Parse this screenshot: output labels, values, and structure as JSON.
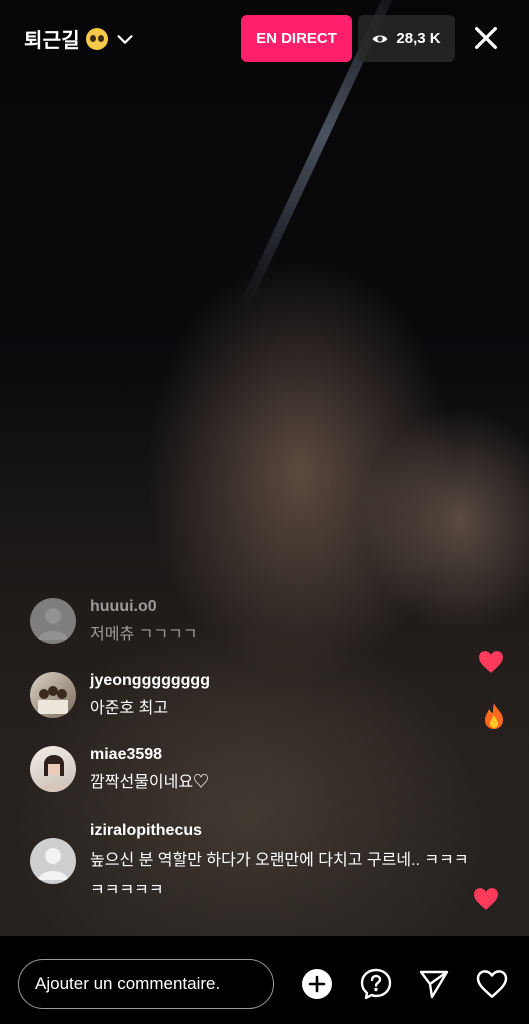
{
  "header": {
    "title": "퇴근길",
    "title_emoji": "pleading-face-emoji",
    "live_label": "EN DIRECT",
    "viewer_count": "28,3 K"
  },
  "comments": [
    {
      "username": "huuui.o0",
      "text": "저메츄 ㄱㄱㄱㄱ",
      "avatar": "default-avatar",
      "faded": true
    },
    {
      "username": "jyeongggggggg",
      "text": "아준호 최고",
      "avatar": "group-photo-avatar"
    },
    {
      "username": "miae3598",
      "text": "깜짝선물이네요♡",
      "avatar": "photo-avatar"
    },
    {
      "username": "iziralopithecus",
      "text": "높으신 분 역할만 하다가 오랜만에 다치고 구르네.. ㅋㅋㅋㅋㅋㅋㅋㅋ",
      "avatar": "default-avatar"
    }
  ],
  "reactions": [
    "heart",
    "fire",
    "heart"
  ],
  "bottom_bar": {
    "comment_placeholder": "Ajouter un commentaire.",
    "icons": [
      "plus-circle-icon",
      "question-icon",
      "send-icon",
      "heart-icon"
    ]
  },
  "colors": {
    "live_pill": "#ff1f6b",
    "heart": "#ff3b5c"
  }
}
